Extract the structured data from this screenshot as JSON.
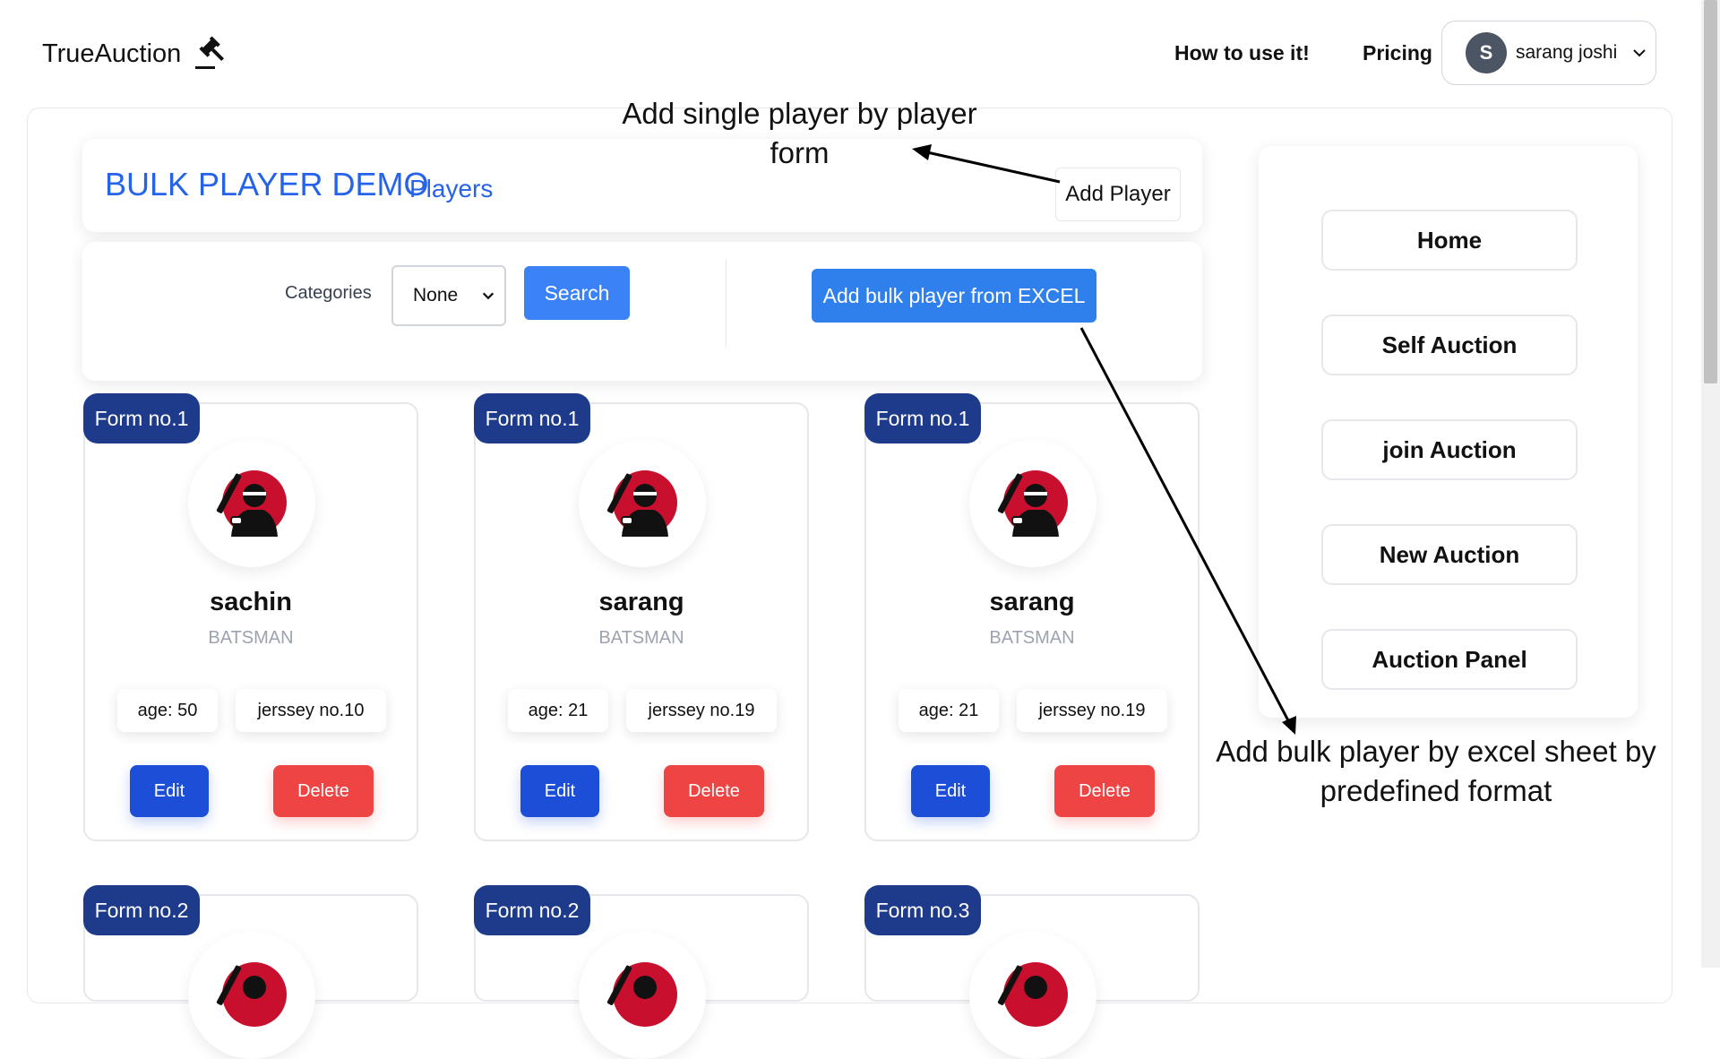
{
  "header": {
    "brand": "TrueAuction",
    "nav": [
      {
        "label": "How to use it!"
      },
      {
        "label": "Pricing"
      }
    ],
    "user": {
      "initial": "S",
      "name": "sarang joshi"
    }
  },
  "title_card": {
    "title": "BULK PLAYER DEMO",
    "subtitle": "Players",
    "add_player_label": "Add Player"
  },
  "filters": {
    "categories_label": "Categories",
    "selected_category": "None",
    "search_label": "Search",
    "bulk_label": "Add bulk player from EXCEL"
  },
  "players": [
    {
      "form": "Form no.1",
      "name": "sachin",
      "role": "BATSMAN",
      "age": "age: 50",
      "jersey": "jerssey no.10",
      "edit": "Edit",
      "delete": "Delete"
    },
    {
      "form": "Form no.1",
      "name": "sarang",
      "role": "BATSMAN",
      "age": "age: 21",
      "jersey": "jerssey no.19",
      "edit": "Edit",
      "delete": "Delete"
    },
    {
      "form": "Form no.1",
      "name": "sarang",
      "role": "BATSMAN",
      "age": "age: 21",
      "jersey": "jerssey no.19",
      "edit": "Edit",
      "delete": "Delete"
    },
    {
      "form": "Form no.2"
    },
    {
      "form": "Form no.2"
    },
    {
      "form": "Form no.3"
    }
  ],
  "sidebar": {
    "items": [
      {
        "label": "Home"
      },
      {
        "label": "Self Auction"
      },
      {
        "label": "join Auction"
      },
      {
        "label": "New Auction"
      },
      {
        "label": "Auction Panel"
      }
    ]
  },
  "annotations": {
    "single_line1": "Add single player by player",
    "single_line2": "form",
    "bulk_line1": "Add bulk player by excel sheet by",
    "bulk_line2": "predefined format"
  },
  "colors": {
    "primary": "#2563eb",
    "badge": "#1e3a8a",
    "edit": "#1d4ed8",
    "delete": "#ef4444",
    "logo_red": "#c8102e"
  }
}
